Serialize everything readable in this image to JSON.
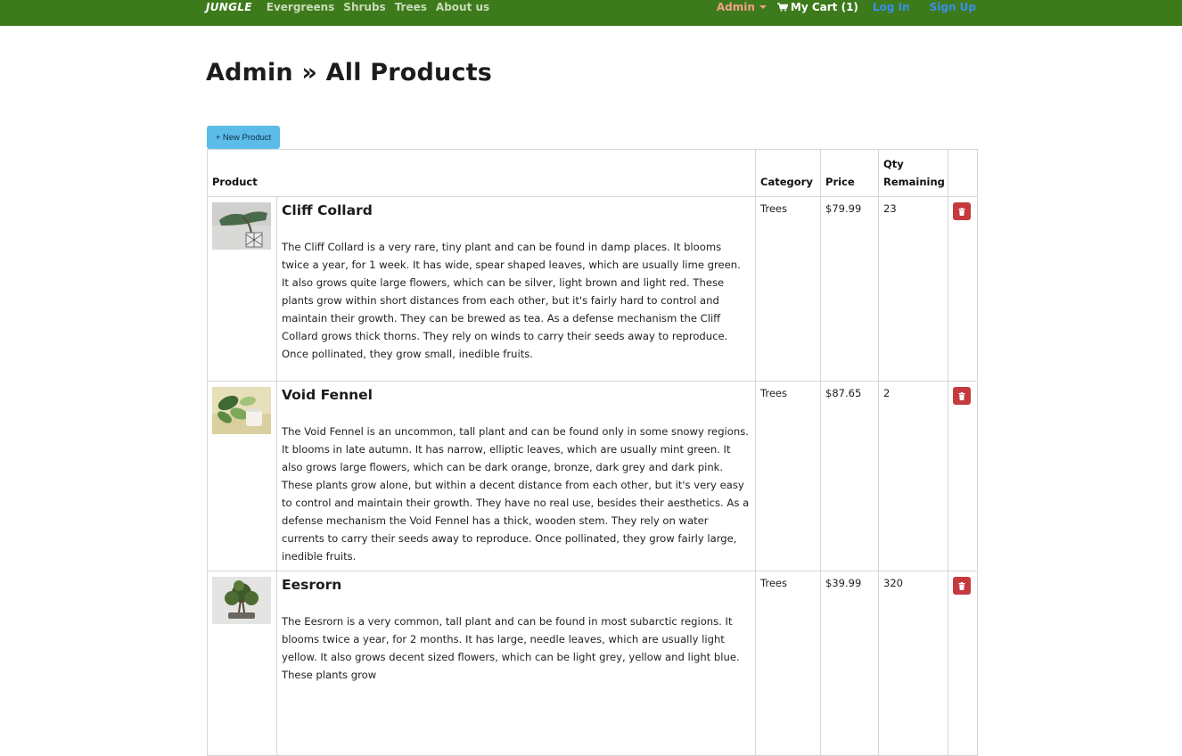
{
  "nav": {
    "brand": "JUNGLE",
    "links": [
      "Evergreens",
      "Shrubs",
      "Trees",
      "About us"
    ],
    "admin_label": "Admin",
    "cart_label": "My Cart (1)",
    "login_label": "Log In",
    "signup_label": "Sign Up"
  },
  "page": {
    "title": "Admin » All Products",
    "new_product_label": "+ New Product"
  },
  "table": {
    "headers": {
      "product": "Product",
      "category": "Category",
      "price": "Price",
      "qty_line1": "Qty",
      "qty_line2": "Remaining"
    },
    "rows": [
      {
        "name": "Cliff Collard",
        "description": "The Cliff Collard is a very rare, tiny plant and can be found in damp places. It blooms twice a year, for 1 week. It has wide, spear shaped leaves, which are usually lime green. It also grows quite large flowers, which can be silver, light brown and light red. These plants grow within short distances from each other, but it's fairly hard to control and maintain their growth. They can be brewed as tea. As a defense mechanism the Cliff Collard grows thick thorns. They rely on winds to carry their seeds away to reproduce. Once pollinated, they grow small, inedible fruits.",
        "category": "Trees",
        "price": "$79.99",
        "qty": "23"
      },
      {
        "name": "Void Fennel",
        "description": "The Void Fennel is an uncommon, tall plant and can be found only in some snowy regions. It blooms in late autumn. It has narrow, elliptic leaves, which are usually mint green. It also grows large flowers, which can be dark orange, bronze, dark grey and dark pink. These plants grow alone, but within a decent distance from each other, but it's very easy to control and maintain their growth. They have no real use, besides their aesthetics. As a defense mechanism the Void Fennel has a thick, wooden stem. They rely on water currents to carry their seeds away to reproduce. Once pollinated, they grow fairly large, inedible fruits.",
        "category": "Trees",
        "price": "$87.65",
        "qty": "2"
      },
      {
        "name": "Eesrorn",
        "description": "The Eesrorn is a very common, tall plant and can be found in most subarctic regions. It blooms twice a year, for 2 months. It has large, needle leaves, which are usually light yellow. It also grows decent sized flowers, which can be light grey, yellow and light blue. These plants grow",
        "category": "Trees",
        "price": "$39.99",
        "qty": "320"
      }
    ]
  },
  "colors": {
    "navbar": "#3d7a1b",
    "new_button": "#5bbce8",
    "delete_button": "#c53a3f",
    "link_blue": "#3b8eea",
    "admin_link": "#f0a08a"
  },
  "icons": {
    "cart": "cart-icon",
    "delete": "trash-icon",
    "admin_dropdown": "caret-down-icon"
  }
}
